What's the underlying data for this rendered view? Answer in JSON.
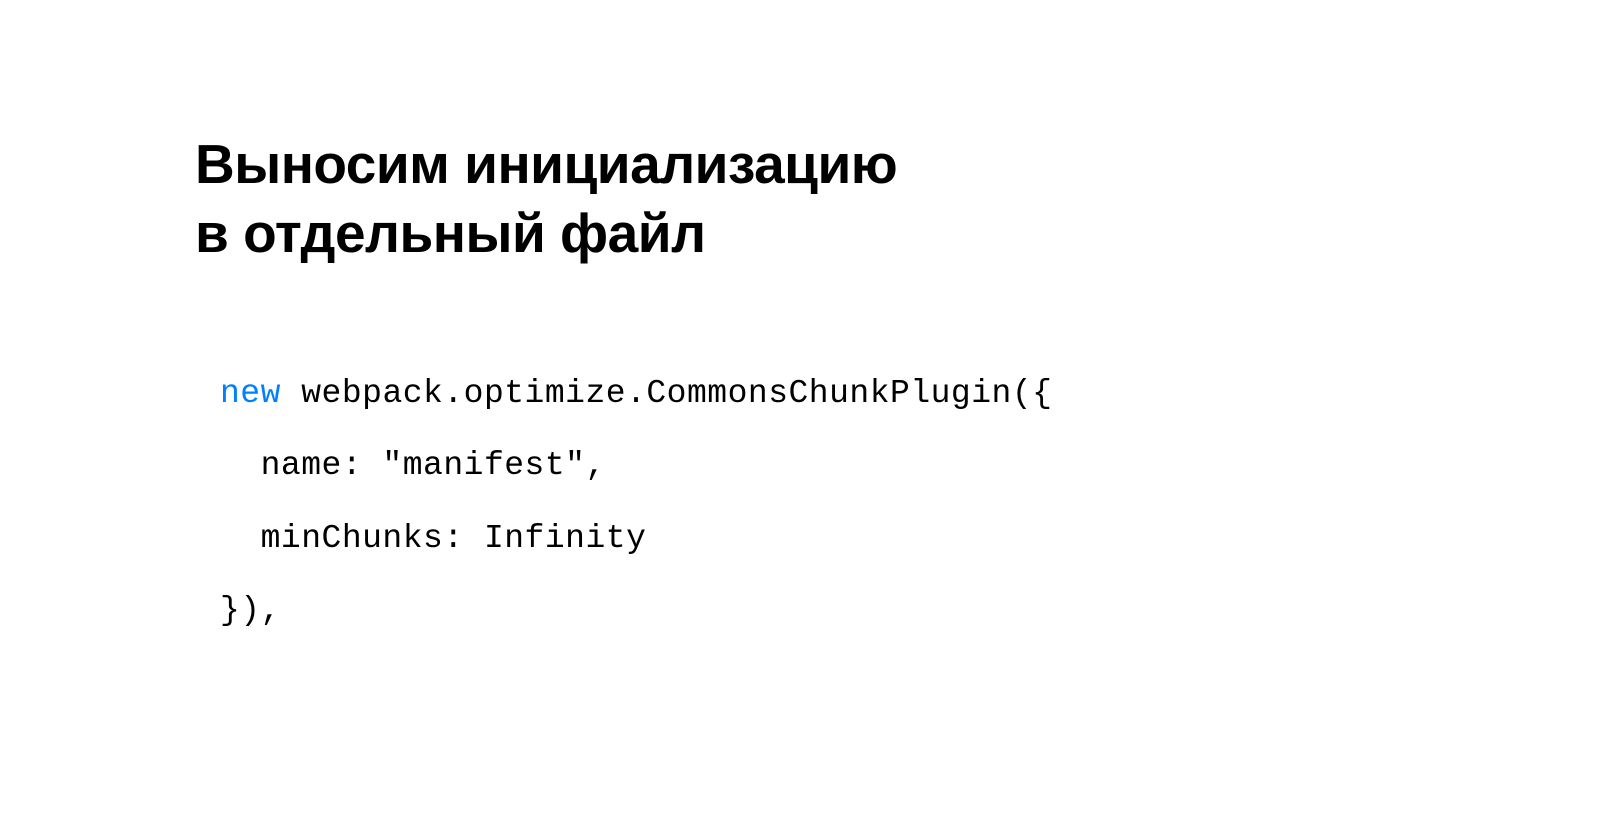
{
  "slide": {
    "title_line1": "Выносим инициализацию",
    "title_line2": "в отдельный файл"
  },
  "code": {
    "keyword": "new",
    "line1_rest": " webpack.optimize.CommonsChunkPlugin({",
    "line2": "  name: \"manifest\",",
    "line3": "  minChunks: Infinity",
    "line4": "}),"
  }
}
